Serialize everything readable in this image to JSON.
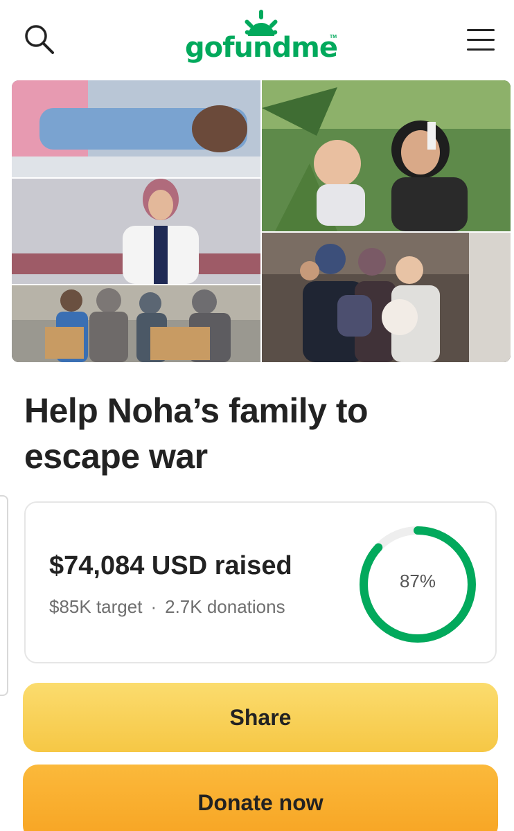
{
  "header": {
    "logo_text": "gofundme",
    "logo_tm": "TM",
    "search_icon": "search-icon",
    "menu_icon": "hamburger-menu-icon",
    "brand_color": "#02a95c"
  },
  "hero": {
    "image_description_icon": "photo-collage"
  },
  "campaign": {
    "title": "Help Noha’s family to escape war"
  },
  "progress": {
    "raised": "$74,084 USD raised",
    "target": "$85K target",
    "separator": "·",
    "donations": "2.7K donations",
    "percent_label": "87%",
    "percent_value": 0.87,
    "ring_color": "#02a95c",
    "track_color": "#eeeeee"
  },
  "actions": {
    "share_label": "Share",
    "donate_label": "Donate now"
  }
}
